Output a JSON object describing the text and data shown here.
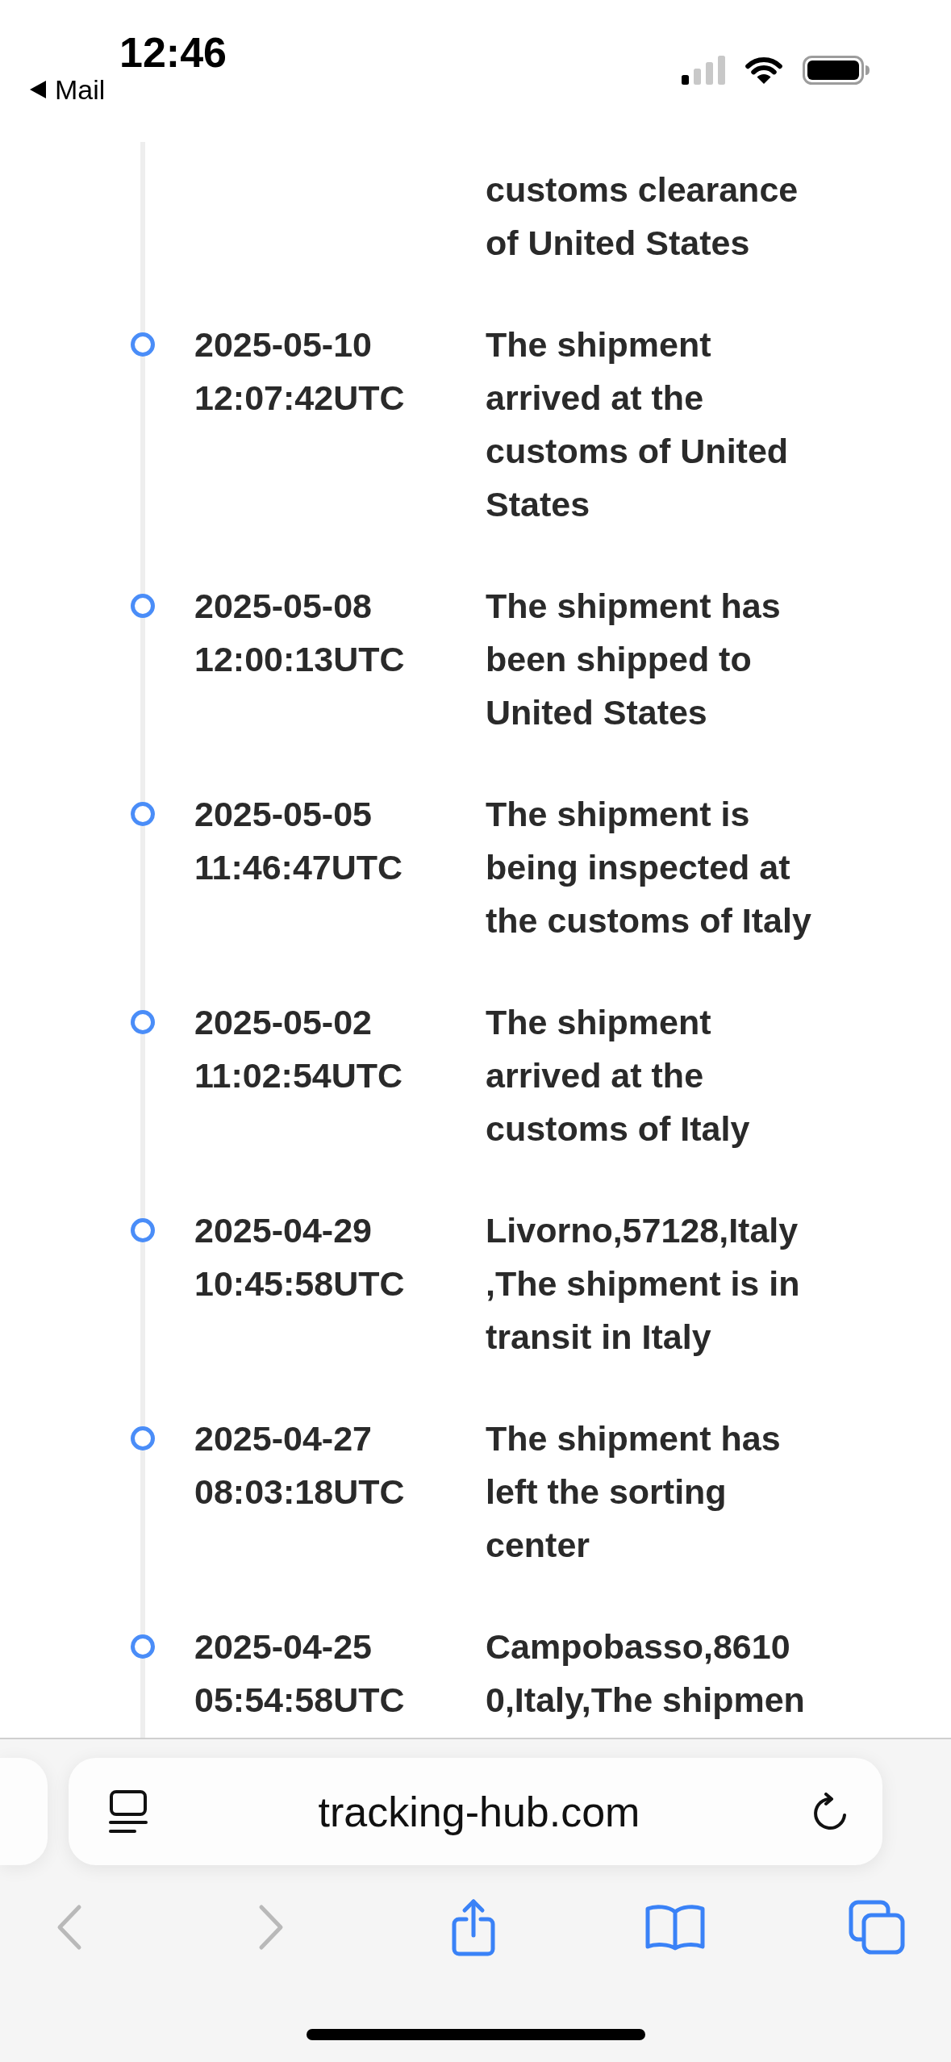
{
  "status_bar": {
    "time": "12:46",
    "back_link": "Mail"
  },
  "timeline": [
    {
      "description": "customs clearance\nof United States"
    },
    {
      "date": "2025-05-10",
      "time": "12:07:42UTC",
      "description": "The shipment\narrived at the\ncustoms of United\nStates"
    },
    {
      "date": "2025-05-08",
      "time": "12:00:13UTC",
      "description": "The shipment has\nbeen shipped to\nUnited States"
    },
    {
      "date": "2025-05-05",
      "time": "11:46:47UTC",
      "description": "The shipment is\nbeing inspected at\nthe customs of Italy"
    },
    {
      "date": "2025-05-02",
      "time": "11:02:54UTC",
      "description": "The shipment\narrived at the\ncustoms of Italy"
    },
    {
      "date": "2025-04-29",
      "time": "10:45:58UTC",
      "description": "Livorno,57128,Italy\n,The shipment is in\ntransit in Italy"
    },
    {
      "date": "2025-04-27",
      "time": "08:03:18UTC",
      "description": "The shipment has\nleft the sorting\ncenter"
    },
    {
      "date": "2025-04-25",
      "time": "05:54:58UTC",
      "description": "Campobasso,8610\n0,Italy,The shipmen"
    }
  ],
  "browser": {
    "url": "tracking-hub.com",
    "toolbar": [
      {
        "kind": "back",
        "disabled": true
      },
      {
        "kind": "forward",
        "disabled": true
      },
      {
        "kind": "share",
        "disabled": false
      },
      {
        "kind": "bookmarks",
        "disabled": false
      },
      {
        "kind": "tabs",
        "disabled": false
      }
    ]
  }
}
